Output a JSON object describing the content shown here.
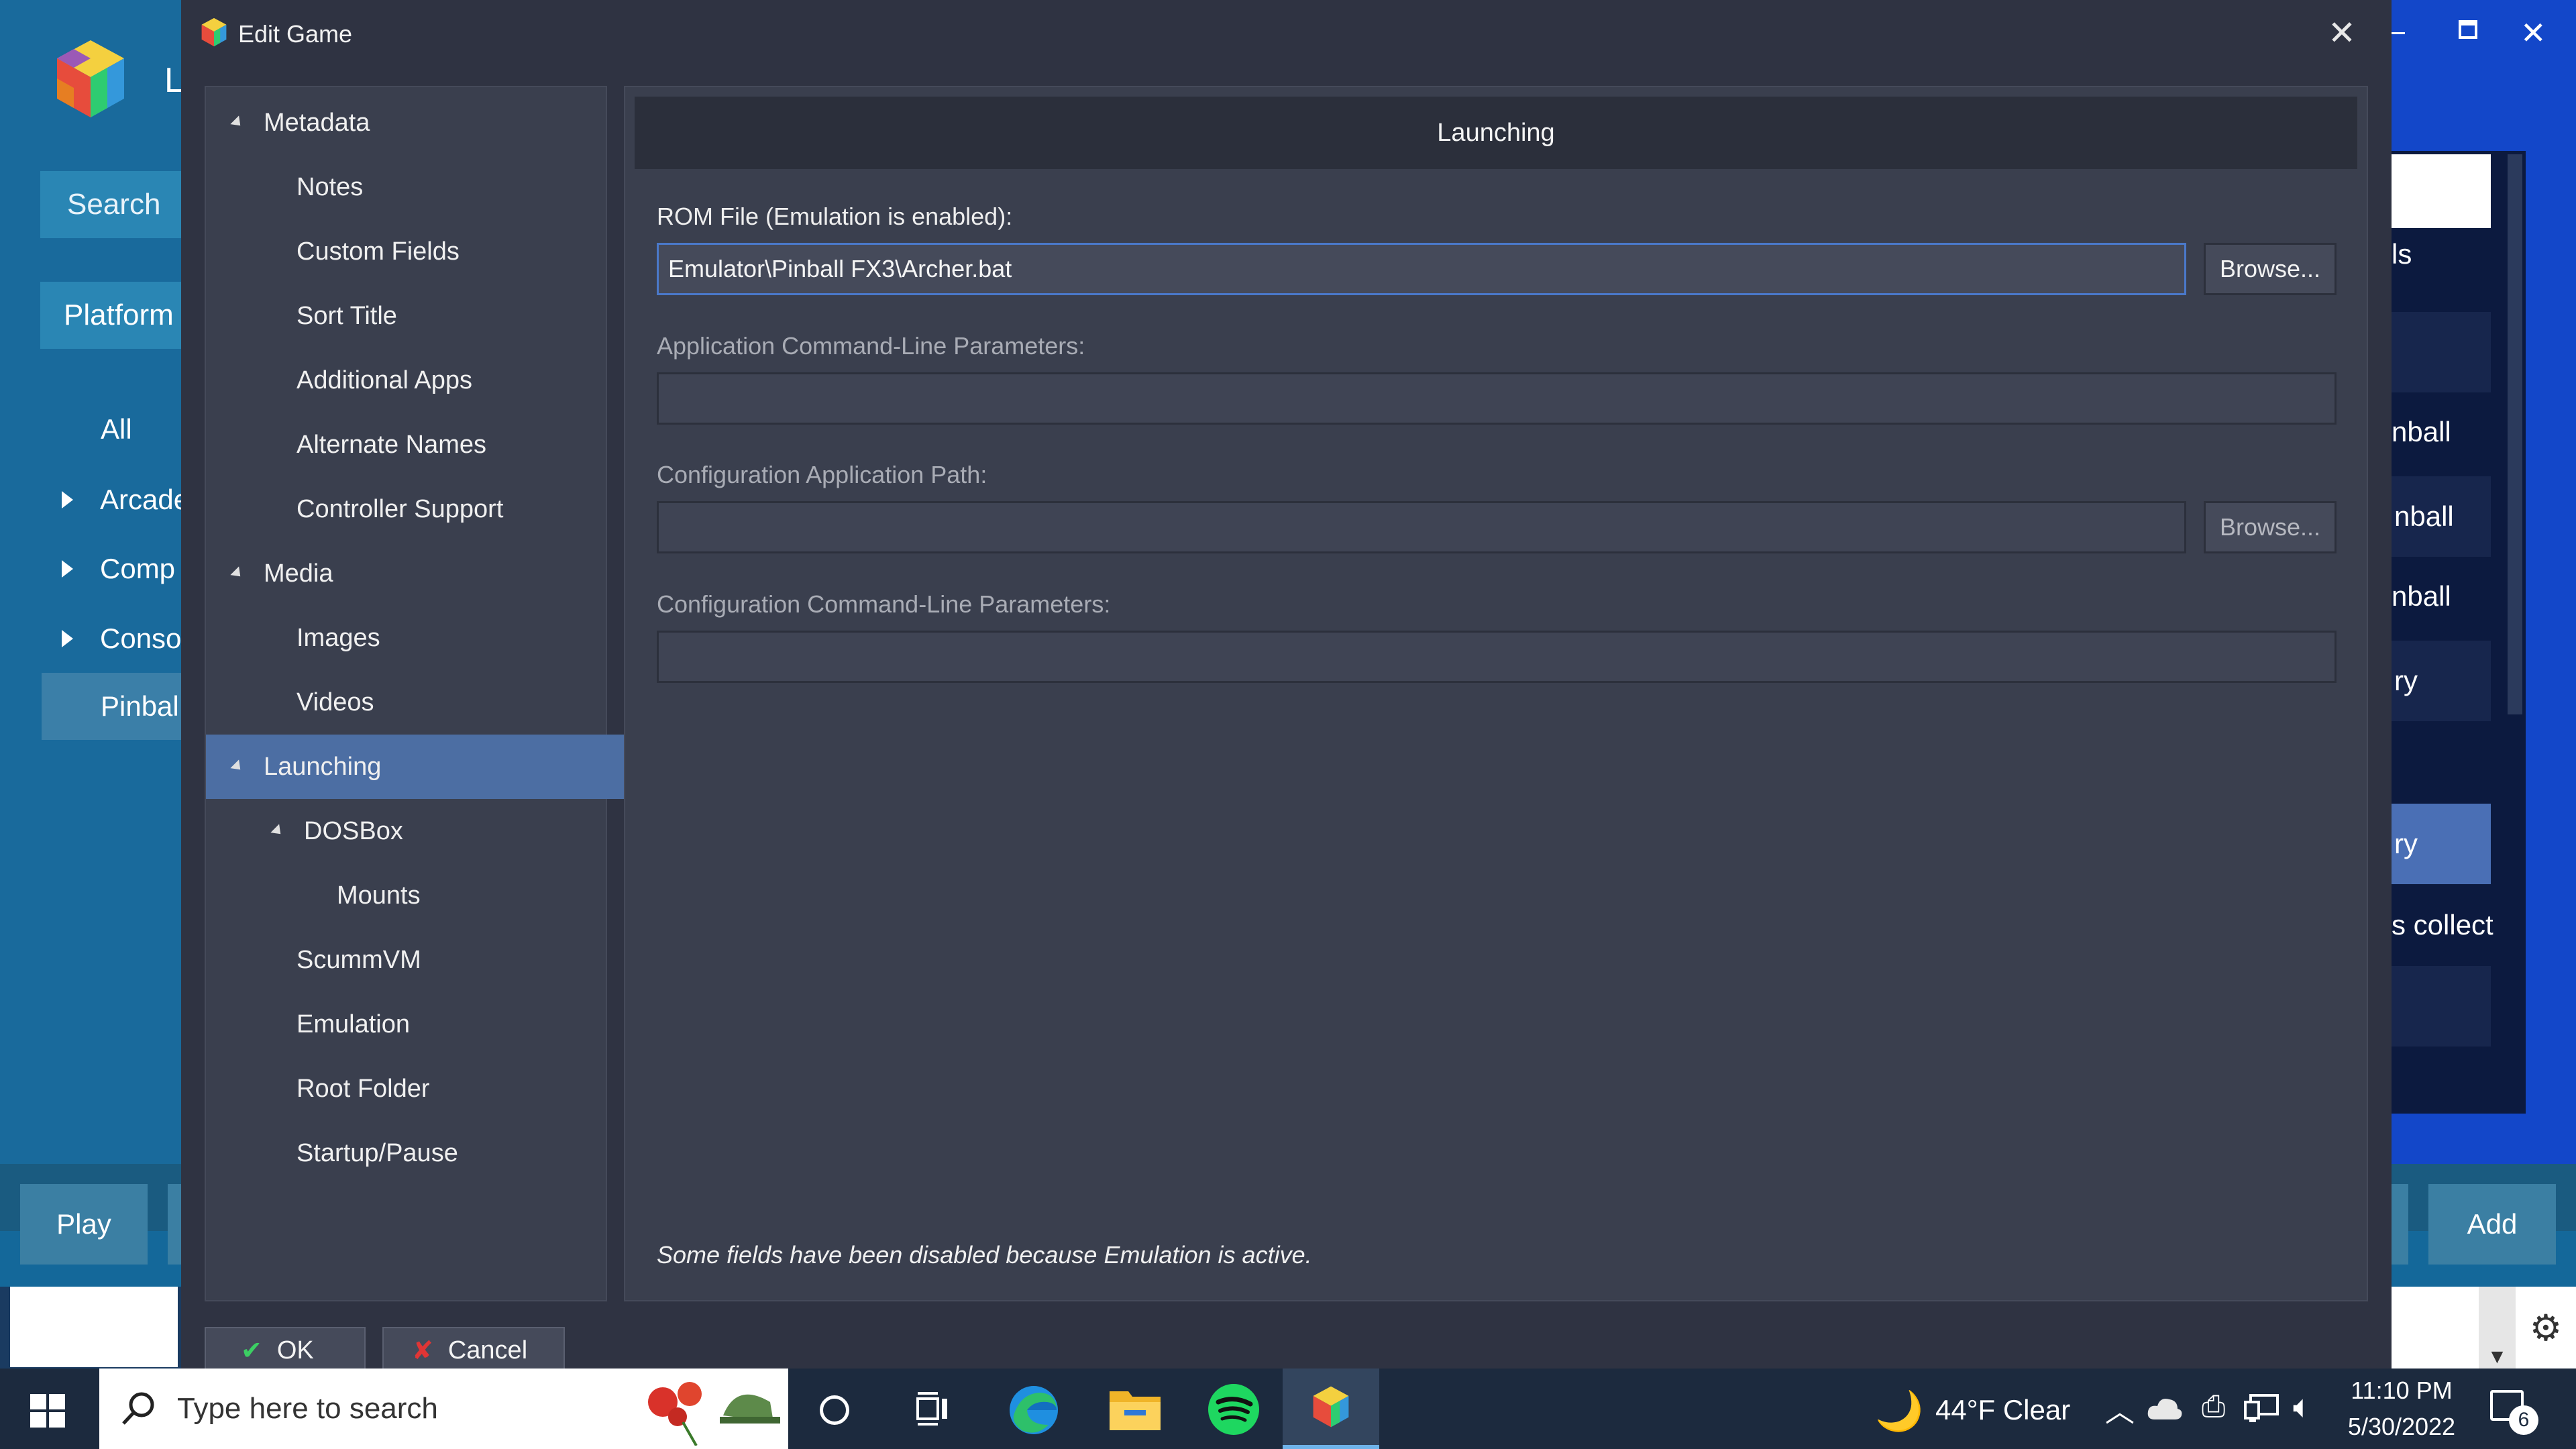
{
  "background_app": {
    "title_fragment": "L",
    "search_label": "Search",
    "platform_label": "Platform",
    "tree": [
      {
        "label": "All",
        "expandable": false
      },
      {
        "label": "Arcade",
        "expandable": true
      },
      {
        "label": "Comp",
        "expandable": true
      },
      {
        "label": "Conso",
        "expandable": true
      },
      {
        "label": "Pinbal",
        "expandable": false,
        "selected": true
      }
    ],
    "right_fragments": [
      "ls",
      "nball",
      "nball",
      "nball",
      "ry",
      "ry",
      "s collect"
    ],
    "play_label": "Play",
    "add_label": "Add"
  },
  "dialog": {
    "title": "Edit Game",
    "close_icon": "close-icon",
    "tree": [
      {
        "label": "Metadata",
        "level": 0,
        "expanded": true
      },
      {
        "label": "Notes",
        "level": 1
      },
      {
        "label": "Custom Fields",
        "level": 1
      },
      {
        "label": "Sort Title",
        "level": 1
      },
      {
        "label": "Additional Apps",
        "level": 1
      },
      {
        "label": "Alternate Names",
        "level": 1
      },
      {
        "label": "Controller Support",
        "level": 1
      },
      {
        "label": "Media",
        "level": 0,
        "expanded": true
      },
      {
        "label": "Images",
        "level": 1
      },
      {
        "label": "Videos",
        "level": 1
      },
      {
        "label": "Launching",
        "level": 0,
        "expanded": true,
        "selected": true
      },
      {
        "label": "DOSBox",
        "level": 1,
        "expanded": true
      },
      {
        "label": "Mounts",
        "level": 2
      },
      {
        "label": "ScummVM",
        "level": 1
      },
      {
        "label": "Emulation",
        "level": 1
      },
      {
        "label": "Root Folder",
        "level": 1
      },
      {
        "label": "Startup/Pause",
        "level": 1
      }
    ],
    "section_title": "Launching",
    "rom_label": "ROM File (Emulation is enabled):",
    "rom_value": "Emulator\\Pinball FX3\\Archer.bat",
    "browse_label": "Browse...",
    "app_params_label": "Application Command-Line Parameters:",
    "app_params_value": "",
    "config_path_label": "Configuration Application Path:",
    "config_path_value": "",
    "config_params_label": "Configuration Command-Line Parameters:",
    "config_params_value": "",
    "note": "Some fields have been disabled because Emulation is active.",
    "ok_label": "OK",
    "cancel_label": "Cancel"
  },
  "taskbar": {
    "search_placeholder": "Type here to search",
    "weather": "44°F  Clear",
    "time": "11:10 PM",
    "date": "5/30/2022",
    "notification_count": "6",
    "pinned_apps": [
      "cortana-icon",
      "task-view-icon",
      "edge-icon",
      "file-explorer-icon",
      "spotify-icon",
      "launchbox-icon"
    ]
  },
  "colors": {
    "dialog_bg": "#2f3342",
    "panel_bg": "#3a3f4e",
    "selection": "#4c6ea3",
    "background_app_blue": "#14689a",
    "taskbar_bg": "#1c2a3e",
    "spotify_green": "#1ed760"
  }
}
